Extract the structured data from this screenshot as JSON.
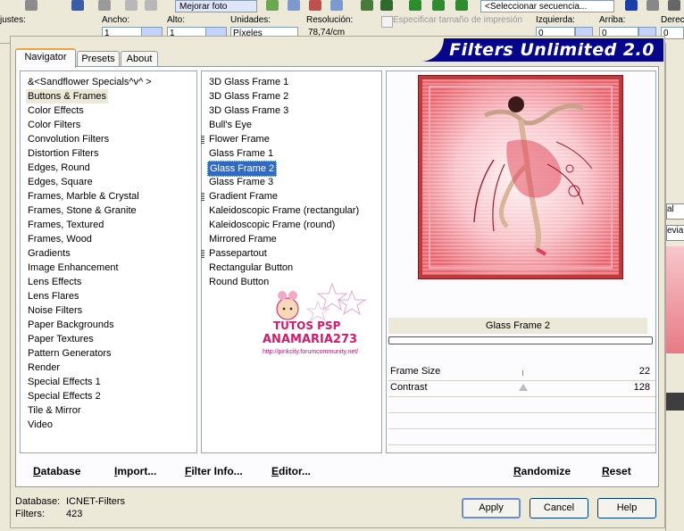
{
  "host": {
    "labels": {
      "ajustes": "justes:",
      "ancho": "Ancho:",
      "alto": "Alto:",
      "unidades": "Unidades:",
      "resolucion": "Resolución:",
      "especificar": "Especificar tamaño de impresión",
      "izquierda": "Izquierda:",
      "arriba": "Arriba:",
      "derecha": "Derech"
    },
    "mejorar_foto": "Mejorar foto",
    "secuencia": "<Seleccionar secuencia...",
    "ancho_value": "1",
    "alto_value": "1",
    "unidades_value": "Píxeles",
    "resolucion_value": "78,74/cm",
    "izquierda_value": "0",
    "arriba_value": "0",
    "derecha_value": "0",
    "side_tab_1": "al",
    "side_tab_2": "evia"
  },
  "dialog": {
    "banner_title": "Filters Unlimited 2.0",
    "tabs": [
      {
        "label": "Navigator",
        "active": true
      },
      {
        "label": "Presets",
        "active": false
      },
      {
        "label": "About",
        "active": false
      }
    ],
    "categories": [
      {
        "label": "&<Sandflower Specials^v^ >"
      },
      {
        "label": "Buttons & Frames",
        "selected": true
      },
      {
        "label": "Color Effects"
      },
      {
        "label": "Color Filters"
      },
      {
        "label": "Convolution Filters"
      },
      {
        "label": "Distortion Filters"
      },
      {
        "label": "Edges, Round"
      },
      {
        "label": "Edges, Square"
      },
      {
        "label": "Frames, Marble & Crystal"
      },
      {
        "label": "Frames, Stone & Granite"
      },
      {
        "label": "Frames, Textured"
      },
      {
        "label": "Frames, Wood"
      },
      {
        "label": "Gradients"
      },
      {
        "label": "Image Enhancement"
      },
      {
        "label": "Lens Effects"
      },
      {
        "label": "Lens Flares"
      },
      {
        "label": "Noise Filters"
      },
      {
        "label": "Paper Backgrounds"
      },
      {
        "label": "Paper Textures"
      },
      {
        "label": "Pattern Generators"
      },
      {
        "label": "Render"
      },
      {
        "label": "Special Effects 1"
      },
      {
        "label": "Special Effects 2"
      },
      {
        "label": "Tile & Mirror"
      },
      {
        "label": "Video"
      }
    ],
    "filters": [
      {
        "label": "3D Glass Frame 1"
      },
      {
        "label": "3D Glass Frame 2"
      },
      {
        "label": "3D Glass Frame 3"
      },
      {
        "label": "Bull's Eye"
      },
      {
        "label": "Flower Frame",
        "marked": true
      },
      {
        "label": "Glass Frame 1"
      },
      {
        "label": "Glass Frame 2",
        "selected": true
      },
      {
        "label": "Glass Frame 3"
      },
      {
        "label": "Gradient Frame",
        "marked": true
      },
      {
        "label": "Kaleidoscopic Frame (rectangular)"
      },
      {
        "label": "Kaleidoscopic Frame (round)"
      },
      {
        "label": "Mirrored Frame"
      },
      {
        "label": "Passepartout",
        "marked": true
      },
      {
        "label": "Rectangular Button"
      },
      {
        "label": "Round Button"
      }
    ],
    "watermark": {
      "title": "TUTOS PSP",
      "name": "ANAMARIA273",
      "url": "http://pinkcity.forumcommunity.net/"
    },
    "preview_caption": "Glass Frame 2",
    "progress": 0,
    "params": [
      {
        "name": "Frame Size",
        "value": "22"
      },
      {
        "name": "Contrast",
        "value": "128"
      }
    ],
    "bottom_links": {
      "database": "Database",
      "import": "Import...",
      "filter_info": "Filter Info...",
      "editor": "Editor...",
      "randomize": "Randomize",
      "reset": "Reset"
    },
    "info": {
      "database_label": "Database:",
      "database_value": "ICNET-Filters",
      "filters_label": "Filters:",
      "filters_value": "423"
    },
    "buttons": {
      "apply": "Apply",
      "cancel": "Cancel",
      "help": "Help"
    }
  },
  "colors": {
    "banner": "#06068c",
    "selection": "#316ac5",
    "frame": "#c0393c",
    "watermark_pink": "#d8196b"
  }
}
